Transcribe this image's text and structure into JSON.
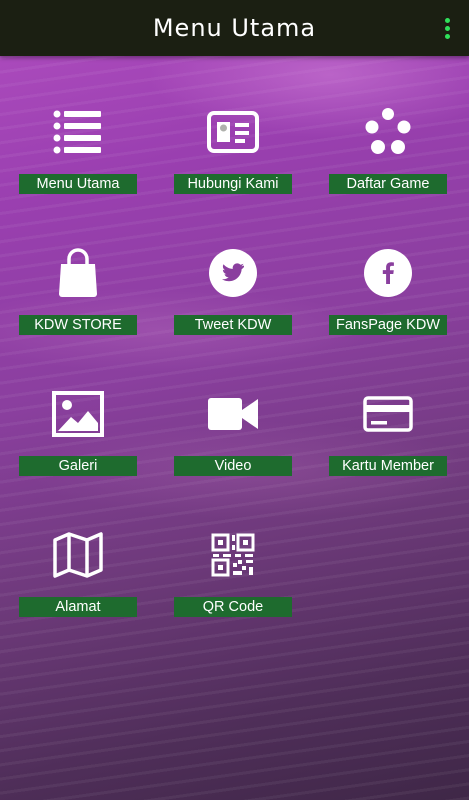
{
  "appbar": {
    "title": "Menu Utama"
  },
  "menu": [
    {
      "label": "Menu Utama",
      "icon": "list-icon"
    },
    {
      "label": "Hubungi Kami",
      "icon": "contact-card-icon"
    },
    {
      "label": "Daftar Game",
      "icon": "loading-dots-icon"
    },
    {
      "label": "KDW STORE",
      "icon": "shopping-bag-icon"
    },
    {
      "label": "Tweet KDW",
      "icon": "twitter-icon"
    },
    {
      "label": "FansPage KDW",
      "icon": "facebook-icon"
    },
    {
      "label": "Galeri",
      "icon": "image-icon"
    },
    {
      "label": "Video",
      "icon": "video-camera-icon"
    },
    {
      "label": "Kartu Member",
      "icon": "credit-card-icon"
    },
    {
      "label": "Alamat",
      "icon": "map-icon"
    },
    {
      "label": "QR Code",
      "icon": "qr-code-icon"
    }
  ],
  "colors": {
    "appbar": "#1b1f12",
    "label_bg": "#1e6b2e",
    "overflow_dots": "#2fe05a",
    "icon": "#ffffff"
  }
}
